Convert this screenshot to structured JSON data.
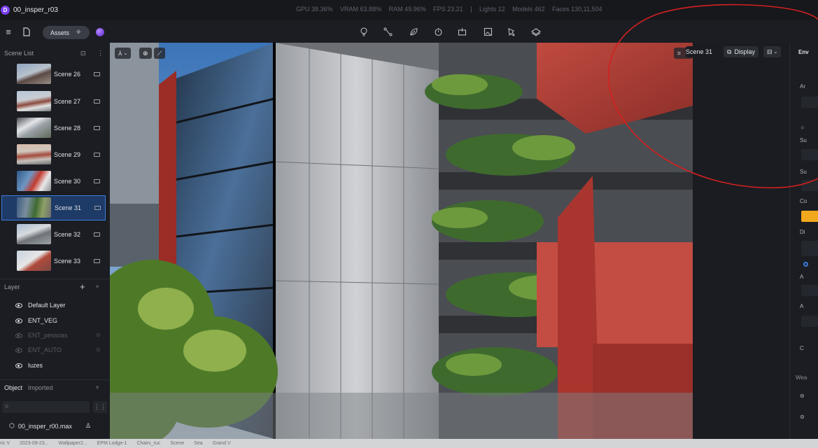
{
  "app": {
    "logo_letter": "D",
    "project_title": "00_insper_r03",
    "stats": [
      "GPU 38.36%",
      "VRAM 63.88%",
      "RAM 49.96%",
      "FPS 23.21",
      "|",
      "Lights 12",
      "Models 462",
      "Faces 130,11,504"
    ]
  },
  "toolbar": {
    "assets_label": "Assets",
    "tool_icons": [
      "bulb-icon",
      "path-icon",
      "leaf-icon",
      "timer-icon",
      "camera-rig-icon",
      "image-icon",
      "pen-icon",
      "layers-icon"
    ]
  },
  "scene_list": {
    "header": "Scene List",
    "selected": "Scene 31",
    "items": [
      {
        "label": "Scene 26"
      },
      {
        "label": "Scene 27"
      },
      {
        "label": "Scene 28"
      },
      {
        "label": "Scene 29"
      },
      {
        "label": "Scene 30"
      },
      {
        "label": "Scene 31"
      },
      {
        "label": "Scene 32"
      },
      {
        "label": "Scene 33"
      }
    ]
  },
  "layers": {
    "header": "Layer",
    "items": [
      {
        "label": "Default Layer",
        "visible": true
      },
      {
        "label": "ENT_VEG",
        "visible": true
      },
      {
        "label": "ENT_pessoas",
        "visible": false
      },
      {
        "label": "ENT_AUTO",
        "visible": false
      },
      {
        "label": "luzes",
        "visible": true
      }
    ]
  },
  "objects": {
    "tab_object": "Object",
    "tab_imported": "Imported",
    "search_placeholder": "",
    "file_name": "00_insper_r00.max"
  },
  "viewport": {
    "scene_label": "Scene 31",
    "display_label": "Display"
  },
  "right_panel": {
    "header": "Env",
    "labels": [
      "Ar",
      "Su",
      "Su",
      "Co",
      "Di",
      "A",
      "A",
      "C",
      "Wea"
    ],
    "accent_color": "#f2a81d"
  },
  "annotation_color": "#d42020",
  "bottom_bar": [
    "ric V",
    "2023-09-23...",
    "Wallpaper2...",
    "EPM Lodge-1",
    "Chairs_ruc",
    "Scene",
    "Sea",
    "Grand V"
  ]
}
